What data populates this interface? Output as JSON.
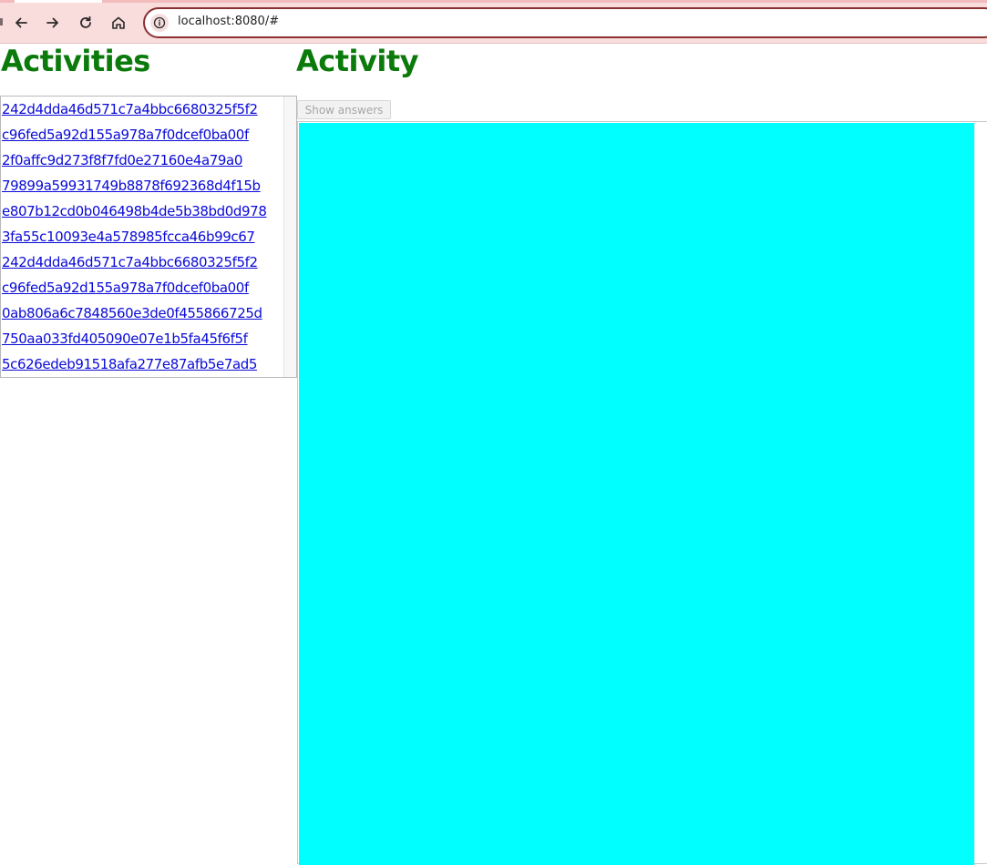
{
  "browser": {
    "url": "localhost:8080/#",
    "icons": [
      "back-icon",
      "forward-icon",
      "reload-icon",
      "home-icon",
      "site-info-icon"
    ]
  },
  "sidebar": {
    "heading": "Activities",
    "items": [
      {
        "label": "242d4dda46d571c7a4bbc6680325f5f2"
      },
      {
        "label": "c96fed5a92d155a978a7f0dcef0ba00f"
      },
      {
        "label": "2f0affc9d273f8f7fd0e27160e4a79a0"
      },
      {
        "label": "79899a59931749b8878f692368d4f15b"
      },
      {
        "label": "e807b12cd0b046498b4de5b38bd0d978"
      },
      {
        "label": "3fa55c10093e4a578985fcca46b99c67"
      },
      {
        "label": "242d4dda46d571c7a4bbc6680325f5f2"
      },
      {
        "label": "c96fed5a92d155a978a7f0dcef0ba00f"
      },
      {
        "label": "0ab806a6c7848560e3de0f455866725d"
      },
      {
        "label": "750aa033fd405090e07e1b5fa45f6f5f"
      },
      {
        "label": "5c626edeb91518afa277e87afb5e7ad5"
      }
    ]
  },
  "main": {
    "heading": "Activity",
    "show_answers_label": "Show answers",
    "frame_color": "#00ffff"
  },
  "colors": {
    "heading": "#0a7a0a",
    "link": "#0a0ad8",
    "chrome": "#f9dcdc"
  }
}
